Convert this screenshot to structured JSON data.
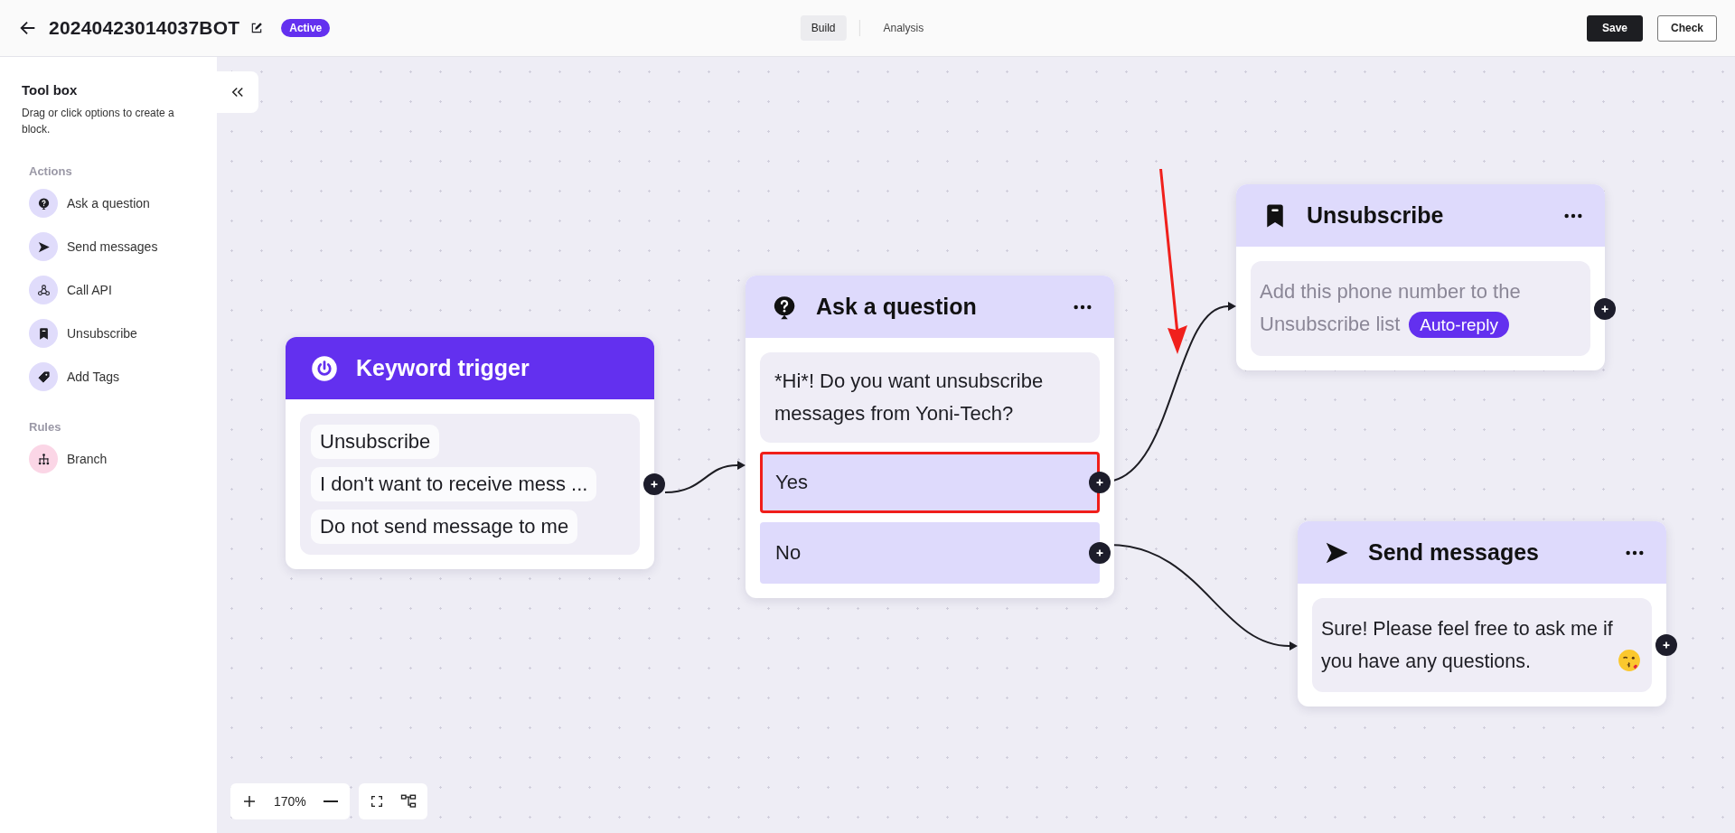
{
  "header": {
    "title": "20240423014037BOT",
    "status_badge": "Active",
    "tabs": [
      {
        "label": "Build",
        "selected": true
      },
      {
        "label": "Analysis",
        "selected": false
      }
    ],
    "buttons": [
      {
        "label": "Save",
        "kind": "primary"
      },
      {
        "label": "Check",
        "kind": "secondary"
      }
    ]
  },
  "toolbox": {
    "title": "Tool box",
    "hint": "Drag or click options to create a block.",
    "sections": [
      {
        "heading": "Actions",
        "items": [
          {
            "label": "Ask a question",
            "kind": "question",
            "color": "#e0dcfb"
          },
          {
            "label": "Send messages",
            "kind": "send",
            "color": "#e0dcfb"
          },
          {
            "label": "Call API",
            "kind": "api",
            "color": "#e0dcfb"
          },
          {
            "label": "Unsubscribe",
            "kind": "unsubscribe",
            "color": "#e0dcfb"
          },
          {
            "label": "Add Tags",
            "kind": "tags",
            "color": "#e0dcfb"
          }
        ]
      },
      {
        "heading": "Rules",
        "items": [
          {
            "label": "Branch",
            "kind": "branch",
            "color": "#fbd6e6"
          }
        ]
      }
    ]
  },
  "nodes": [
    {
      "kind": "trigger",
      "title": "Keyword trigger",
      "keywords": [
        "Unsubscribe",
        "I don't want to receive mess ...",
        "Do not send message to me"
      ]
    },
    {
      "kind": "question",
      "title": "Ask a question",
      "text": "*Hi*! Do you want unsubscribe messages from Yoni-Tech?",
      "options": [
        {
          "label": "Yes",
          "highlighted": true
        },
        {
          "label": "No",
          "highlighted": false
        }
      ]
    },
    {
      "kind": "unsubscribe",
      "title": "Unsubscribe",
      "text": "Add this phone number to the Unsubscribe list",
      "tag": "Auto-reply"
    },
    {
      "kind": "send",
      "title": "Send messages",
      "text": "Sure! Please feel free to ask me if you have any questions."
    }
  ],
  "zoom": {
    "level_text": "170%"
  }
}
